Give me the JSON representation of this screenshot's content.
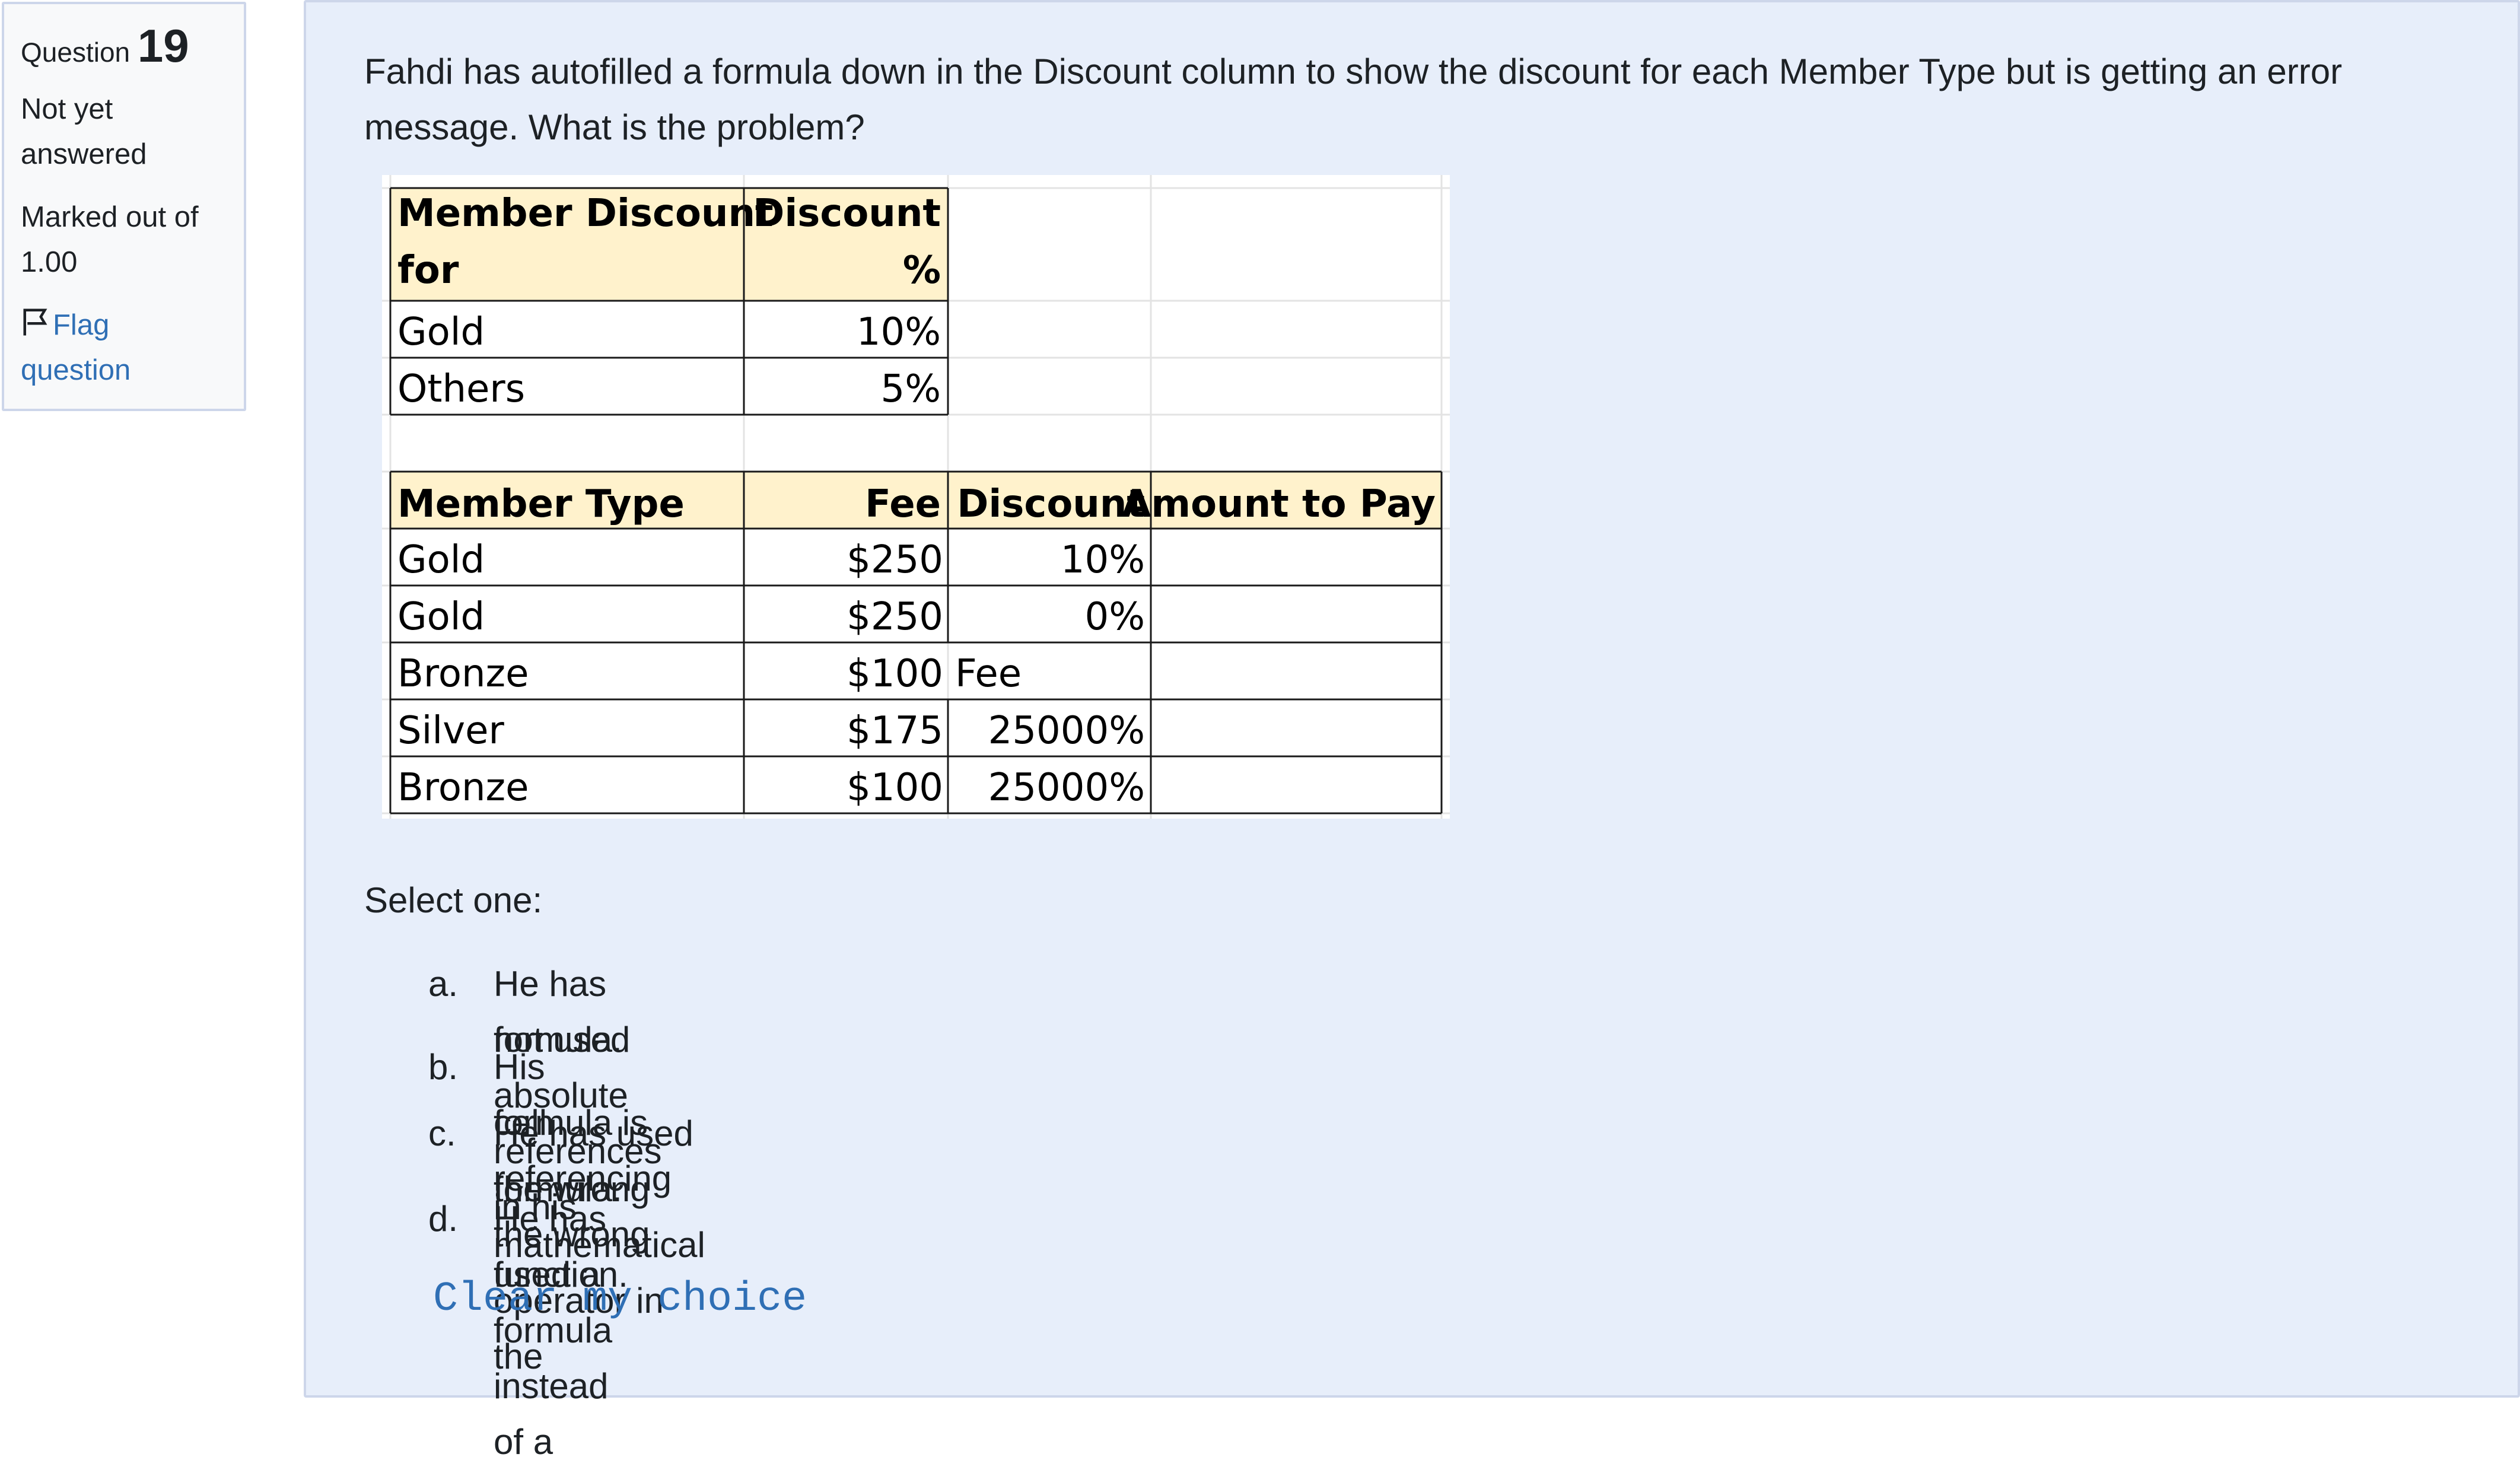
{
  "info": {
    "question_label": "Question",
    "question_number": "19",
    "state_line1": "Not yet",
    "state_line2": "answered",
    "grade_line1": "Marked out of",
    "grade_line2": "1.00",
    "flag_line1": "Flag",
    "flag_line2": "question"
  },
  "question": {
    "text_line1": "Fahdi has autofilled a formula down in the Discount column to show the discount for each Member Type but is getting an error",
    "text_line2": "message. What is the problem?",
    "prompt": "Select one:"
  },
  "spreadsheet": {
    "header_fill": "#fff2cc",
    "table1": {
      "headers": [
        [
          "Member Discount",
          "for"
        ],
        [
          "Discount",
          "%"
        ]
      ],
      "rows": [
        [
          "Gold",
          "10%"
        ],
        [
          "Others",
          "5%"
        ]
      ]
    },
    "table2": {
      "headers": [
        "Member Type",
        "Fee",
        "Discount",
        "Amount to Pay"
      ],
      "rows": [
        [
          "Gold",
          "$250",
          "10%",
          ""
        ],
        [
          "Gold",
          "$250",
          "0%",
          ""
        ],
        [
          "Bronze",
          "$100",
          "Fee",
          ""
        ],
        [
          "Silver",
          "$175",
          "25000%",
          ""
        ],
        [
          "Bronze",
          "$100",
          "25000%",
          ""
        ]
      ]
    }
  },
  "options": [
    {
      "letter": "a.",
      "line1": "He has not used absolute references in his",
      "line2": "formula."
    },
    {
      "letter": "b.",
      "line1": "His formula is referencing the wrong",
      "line2": "cell."
    },
    {
      "letter": "c.",
      "line1": "He has used the wrong mathematical operator in the",
      "line2": "formula."
    },
    {
      "letter": "d.",
      "line1": "He has used a formula instead of a",
      "line2": "function."
    }
  ],
  "clear_choice": "Clear my choice"
}
